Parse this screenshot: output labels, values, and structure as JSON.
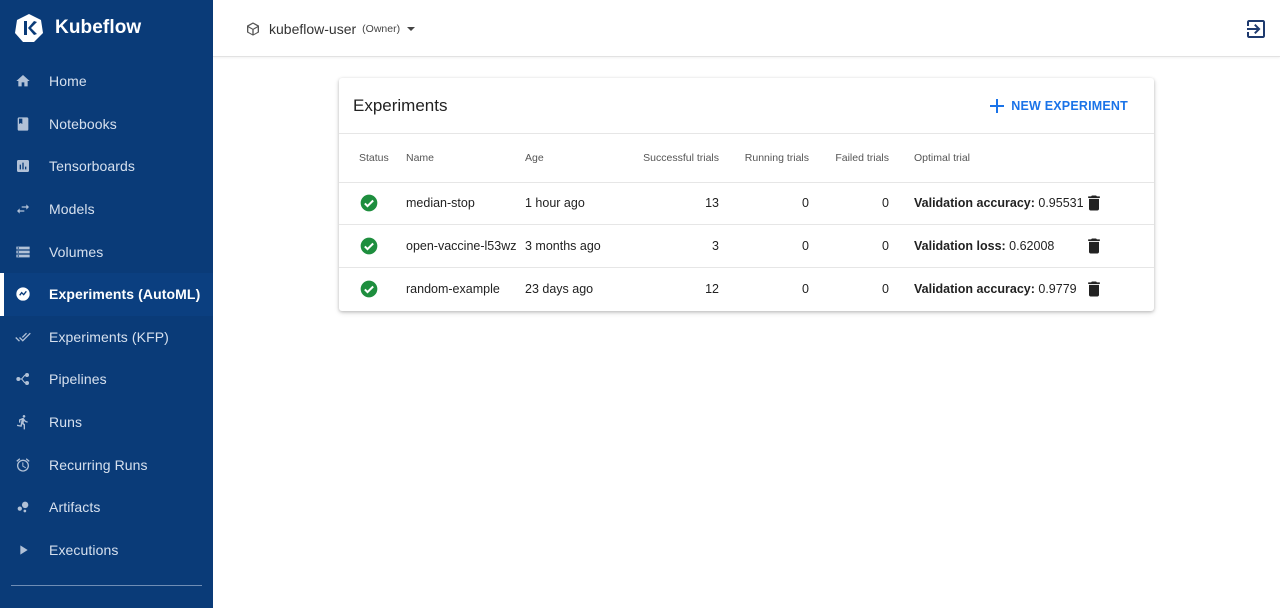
{
  "sidebar": {
    "brand": "Kubeflow",
    "items": [
      {
        "label": "Home",
        "icon": "home-icon"
      },
      {
        "label": "Notebooks",
        "icon": "notebook-icon"
      },
      {
        "label": "Tensorboards",
        "icon": "chart-icon"
      },
      {
        "label": "Models",
        "icon": "arrows-icon"
      },
      {
        "label": "Volumes",
        "icon": "storage-icon"
      },
      {
        "label": "Experiments (AutoML)",
        "icon": "experiment-icon",
        "active": true
      },
      {
        "label": "Experiments (KFP)",
        "icon": "check-double-icon"
      },
      {
        "label": "Pipelines",
        "icon": "pipeline-icon"
      },
      {
        "label": "Runs",
        "icon": "run-icon"
      },
      {
        "label": "Recurring Runs",
        "icon": "alarm-icon"
      },
      {
        "label": "Artifacts",
        "icon": "bubbles-icon"
      },
      {
        "label": "Executions",
        "icon": "play-icon"
      }
    ]
  },
  "topbar": {
    "namespace": "kubeflow-user",
    "role": "(Owner)"
  },
  "card": {
    "title": "Experiments",
    "new_button": "NEW EXPERIMENT",
    "columns": [
      "Status",
      "Name",
      "Age",
      "Successful trials",
      "Running trials",
      "Failed trials",
      "Optimal trial"
    ],
    "rows": [
      {
        "name": "median-stop",
        "age": "1 hour ago",
        "successful": "13",
        "running": "0",
        "failed": "0",
        "opt_label": "Validation accuracy:",
        "opt_value": "0.95531"
      },
      {
        "name": "open-vaccine-l53wz",
        "age": "3 months ago",
        "successful": "3",
        "running": "0",
        "failed": "0",
        "opt_label": "Validation loss:",
        "opt_value": "0.62008"
      },
      {
        "name": "random-example",
        "age": "23 days ago",
        "successful": "12",
        "running": "0",
        "failed": "0",
        "opt_label": "Validation accuracy:",
        "opt_value": "0.9779"
      }
    ]
  },
  "colors": {
    "sidebar_bg": "#0a3b78",
    "accent": "#1a73e8",
    "success": "#1e8e3e"
  }
}
